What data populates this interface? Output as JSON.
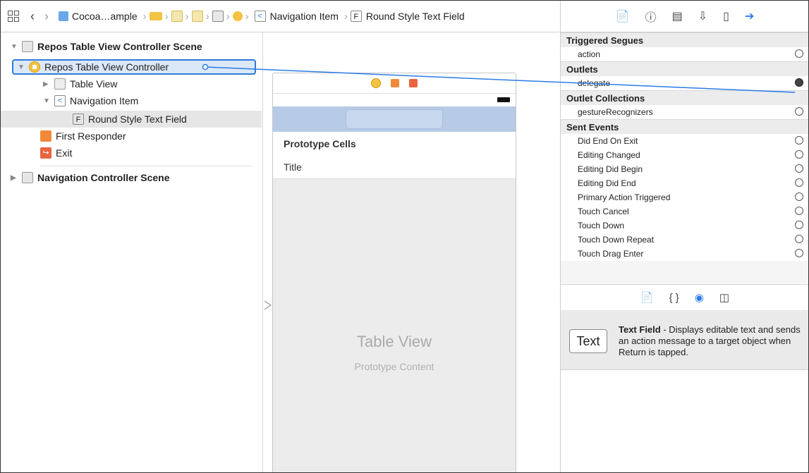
{
  "jumpbar": {
    "project": "Cocoa…ample",
    "nav_item": "Navigation Item",
    "field": "Round Style Text Field",
    "field_letter": "F",
    "nav_letter": "<"
  },
  "outline": {
    "scene1": "Repos Table View Controller Scene",
    "controller": "Repos Table View Controller",
    "table_view": "Table View",
    "nav_item": "Navigation Item",
    "nav_letter": "<",
    "field": "Round Style Text Field",
    "field_letter": "F",
    "first_responder": "First Responder",
    "exit": "Exit",
    "scene2": "Navigation Controller Scene"
  },
  "canvas": {
    "prototype_cells": "Prototype Cells",
    "title_cell": "Title",
    "table_view": "Table View",
    "prototype_content": "Prototype Content"
  },
  "inspector": {
    "sections": [
      {
        "title": "Triggered Segues",
        "items": [
          {
            "label": "action",
            "connected": false
          }
        ]
      },
      {
        "title": "Outlets",
        "items": [
          {
            "label": "delegate",
            "connected": true
          }
        ]
      },
      {
        "title": "Outlet Collections",
        "items": [
          {
            "label": "gestureRecognizers",
            "connected": false
          }
        ]
      },
      {
        "title": "Sent Events",
        "items": [
          {
            "label": "Did End On Exit",
            "connected": false
          },
          {
            "label": "Editing Changed",
            "connected": false
          },
          {
            "label": "Editing Did Begin",
            "connected": false
          },
          {
            "label": "Editing Did End",
            "connected": false
          },
          {
            "label": "Primary Action Triggered",
            "connected": false
          },
          {
            "label": "Touch Cancel",
            "connected": false
          },
          {
            "label": "Touch Down",
            "connected": false
          },
          {
            "label": "Touch Down Repeat",
            "connected": false
          },
          {
            "label": "Touch Drag Enter",
            "connected": false
          }
        ]
      }
    ]
  },
  "library": {
    "item_button": "Text",
    "item_name": "Text Field",
    "item_desc": " - Displays editable text and sends an action message to a target object when Return is tapped."
  },
  "colors": {
    "accent": "#2b7ce9",
    "selection": "#dbe8f8",
    "navbar": "#b7cbe6"
  }
}
